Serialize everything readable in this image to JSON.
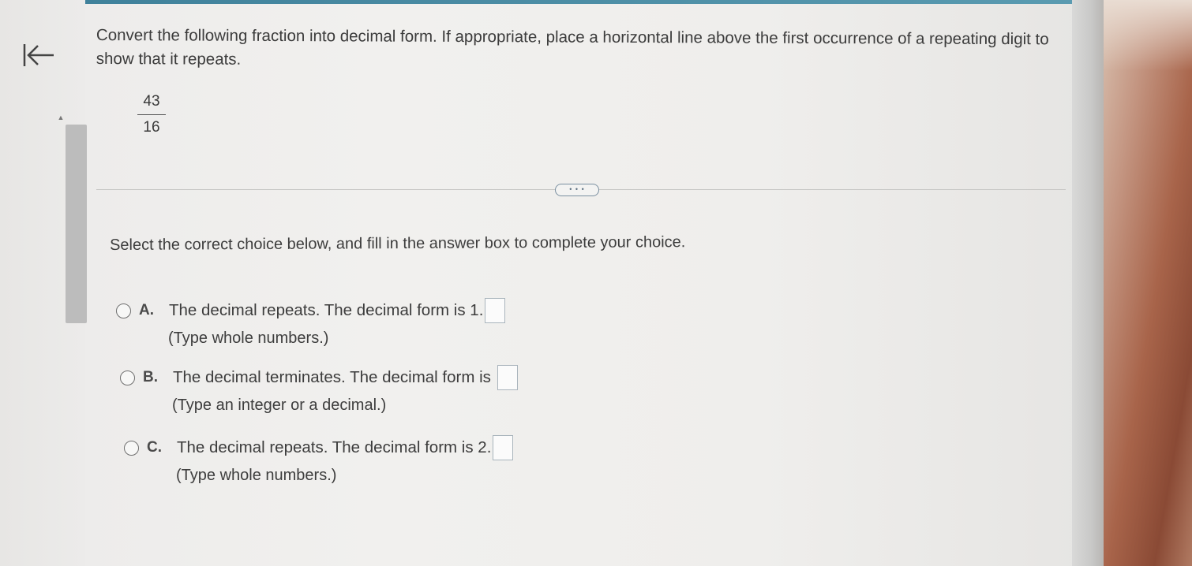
{
  "navigation": {
    "back_icon": "back-arrow-icon"
  },
  "question": {
    "text": "Convert the following fraction into decimal form. If appropriate, place a horizontal line above the first occurrence of a repeating digit to show that it repeats.",
    "fraction": {
      "numerator": "43",
      "denominator": "16"
    }
  },
  "more_button_label": "• • •",
  "instruction": "Select the correct choice below, and fill in the answer box to complete your choice.",
  "choices": [
    {
      "letter": "A.",
      "text": "The decimal repeats. The decimal form is 1.",
      "answer_value": "",
      "hint": "(Type whole numbers.)"
    },
    {
      "letter": "B.",
      "text": "The decimal terminates. The decimal form is",
      "answer_value": "",
      "hint": "(Type an integer or a decimal.)"
    },
    {
      "letter": "C.",
      "text": "The decimal repeats. The decimal form is 2.",
      "answer_value": "",
      "hint": "(Type whole numbers.)"
    }
  ],
  "colors": {
    "accent": "#3d7f99",
    "text": "#3c3c3c",
    "box_border": "#a9b4bc"
  }
}
